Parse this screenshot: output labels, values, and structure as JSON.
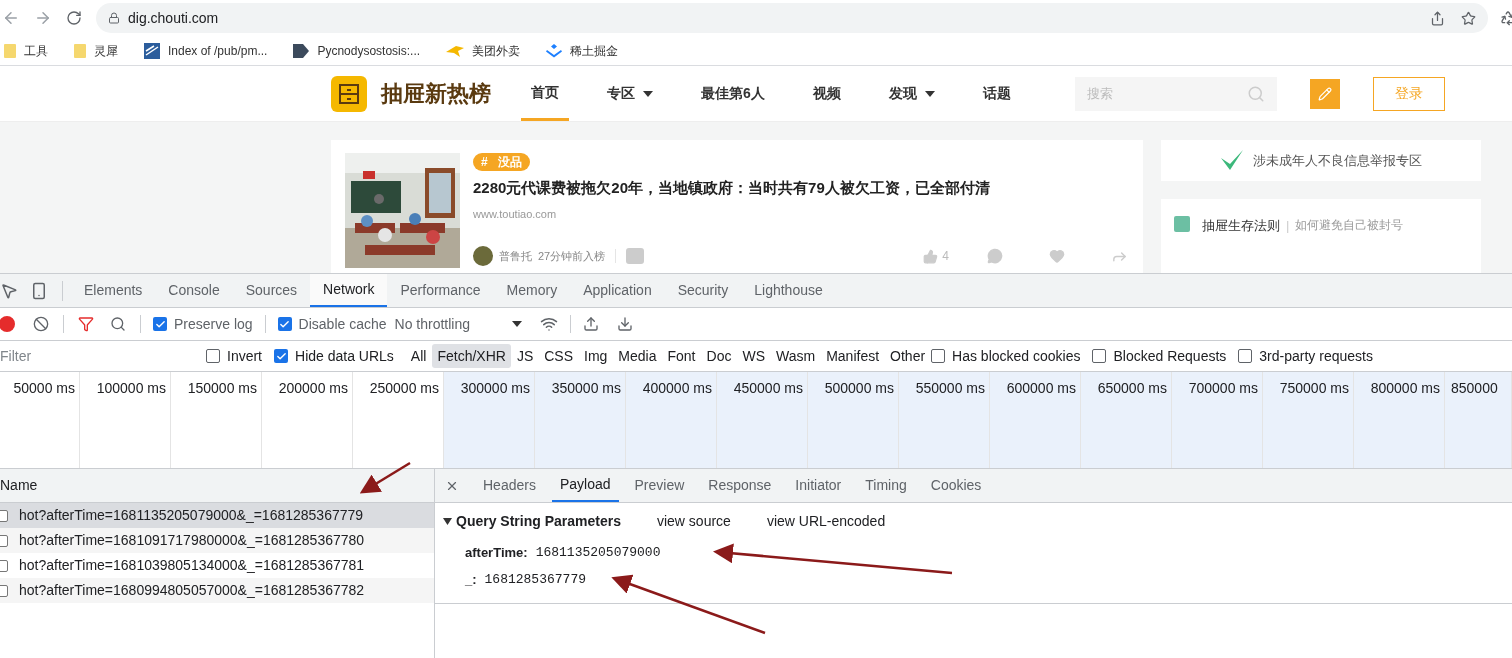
{
  "browser": {
    "url": "dig.chouti.com",
    "bookmarks": [
      {
        "label": "工具",
        "kind": "folder"
      },
      {
        "label": "灵犀",
        "kind": "folder"
      },
      {
        "label": "Index of /pub/pm...",
        "kind": "stripes"
      },
      {
        "label": "Pycnodysostosis:...",
        "kind": "tag"
      },
      {
        "label": "美团外卖",
        "kind": "bird"
      },
      {
        "label": "稀土掘金",
        "kind": "juejin"
      }
    ]
  },
  "site": {
    "logo_text": "抽屉新热榜",
    "nav": [
      {
        "label": "首页",
        "selected": true,
        "dropdown": false
      },
      {
        "label": "专区",
        "selected": false,
        "dropdown": true
      },
      {
        "label": "最佳第6人",
        "selected": false,
        "dropdown": false
      },
      {
        "label": "视频",
        "selected": false,
        "dropdown": false
      },
      {
        "label": "发现",
        "selected": false,
        "dropdown": true
      },
      {
        "label": "话题",
        "selected": false,
        "dropdown": false
      }
    ],
    "search": {
      "placeholder": "搜索"
    },
    "login": "登录",
    "article": {
      "tag_mark": "#",
      "tag": "没品",
      "title": "2280元代课费被拖欠20年，当地镇政府：当时共有79人被欠工资，已全部付清",
      "source": "www.toutiao.com",
      "author": "普鲁托",
      "time": "27分钟前入榜",
      "likes": "4"
    },
    "sidebar": {
      "report": "涉未成年人不良信息举报专区",
      "rule_title": "抽屉生存法则",
      "rule_separator": "|",
      "rule_subtitle": "如何避免自己被封号"
    }
  },
  "devtools": {
    "tabs": [
      {
        "label": "Elements",
        "selected": false
      },
      {
        "label": "Console",
        "selected": false
      },
      {
        "label": "Sources",
        "selected": false
      },
      {
        "label": "Network",
        "selected": true
      },
      {
        "label": "Performance",
        "selected": false
      },
      {
        "label": "Memory",
        "selected": false
      },
      {
        "label": "Application",
        "selected": false
      },
      {
        "label": "Security",
        "selected": false
      },
      {
        "label": "Lighthouse",
        "selected": false
      }
    ],
    "toolbar": {
      "preserve_log": {
        "label": "Preserve log",
        "checked": true
      },
      "disable_cache": {
        "label": "Disable cache",
        "checked": true
      },
      "throttling": "No throttling"
    },
    "filter": {
      "placeholder": "Filter",
      "items": [
        {
          "kind": "checkbox",
          "label": "Invert",
          "checked": false
        },
        {
          "kind": "checkbox",
          "label": "Hide data URLs",
          "checked": true
        },
        {
          "kind": "type",
          "label": "All",
          "selected": false
        },
        {
          "kind": "type",
          "label": "Fetch/XHR",
          "selected": true
        },
        {
          "kind": "type",
          "label": "JS",
          "selected": false
        },
        {
          "kind": "type",
          "label": "CSS",
          "selected": false
        },
        {
          "kind": "type",
          "label": "Img",
          "selected": false
        },
        {
          "kind": "type",
          "label": "Media",
          "selected": false
        },
        {
          "kind": "type",
          "label": "Font",
          "selected": false
        },
        {
          "kind": "type",
          "label": "Doc",
          "selected": false
        },
        {
          "kind": "type",
          "label": "WS",
          "selected": false
        },
        {
          "kind": "type",
          "label": "Wasm",
          "selected": false
        },
        {
          "kind": "type",
          "label": "Manifest",
          "selected": false
        },
        {
          "kind": "type",
          "label": "Other",
          "selected": false
        },
        {
          "kind": "checkbox",
          "label": "Has blocked cookies",
          "checked": false
        },
        {
          "kind": "checkbox",
          "label": "Blocked Requests",
          "checked": false
        },
        {
          "kind": "checkbox",
          "label": "3rd-party requests",
          "checked": false
        }
      ]
    },
    "timeline": [
      {
        "label": "50000 ms",
        "selected": false
      },
      {
        "label": "100000 ms",
        "selected": false
      },
      {
        "label": "150000 ms",
        "selected": false
      },
      {
        "label": "200000 ms",
        "selected": false
      },
      {
        "label": "250000 ms",
        "selected": false
      },
      {
        "label": "300000 ms",
        "selected": true
      },
      {
        "label": "350000 ms",
        "selected": true
      },
      {
        "label": "400000 ms",
        "selected": true
      },
      {
        "label": "450000 ms",
        "selected": true
      },
      {
        "label": "500000 ms",
        "selected": true
      },
      {
        "label": "550000 ms",
        "selected": true
      },
      {
        "label": "600000 ms",
        "selected": true
      },
      {
        "label": "650000 ms",
        "selected": true
      },
      {
        "label": "700000 ms",
        "selected": true
      },
      {
        "label": "750000 ms",
        "selected": true
      },
      {
        "label": "800000 ms",
        "selected": true
      },
      {
        "label": "850000",
        "selected": true
      }
    ],
    "requests": {
      "header": "Name",
      "rows": [
        {
          "name": "hot?afterTime=1681135205079000&_=1681285367779",
          "selected": true
        },
        {
          "name": "hot?afterTime=1681091717980000&_=1681285367780",
          "selected": false
        },
        {
          "name": "hot?afterTime=1681039805134000&_=1681285367781",
          "selected": false
        },
        {
          "name": "hot?afterTime=1680994805057000&_=1681285367782",
          "selected": false
        }
      ]
    },
    "detail": {
      "tabs": [
        {
          "label": "Headers",
          "selected": false
        },
        {
          "label": "Payload",
          "selected": true
        },
        {
          "label": "Preview",
          "selected": false
        },
        {
          "label": "Response",
          "selected": false
        },
        {
          "label": "Initiator",
          "selected": false
        },
        {
          "label": "Timing",
          "selected": false
        },
        {
          "label": "Cookies",
          "selected": false
        }
      ],
      "section": "Query String Parameters",
      "view_source": "view source",
      "view_url_encoded": "view URL-encoded",
      "params": [
        {
          "key": "afterTime:",
          "value": "1681135205079000"
        },
        {
          "key": "_:",
          "value": "1681285367779"
        }
      ]
    }
  }
}
